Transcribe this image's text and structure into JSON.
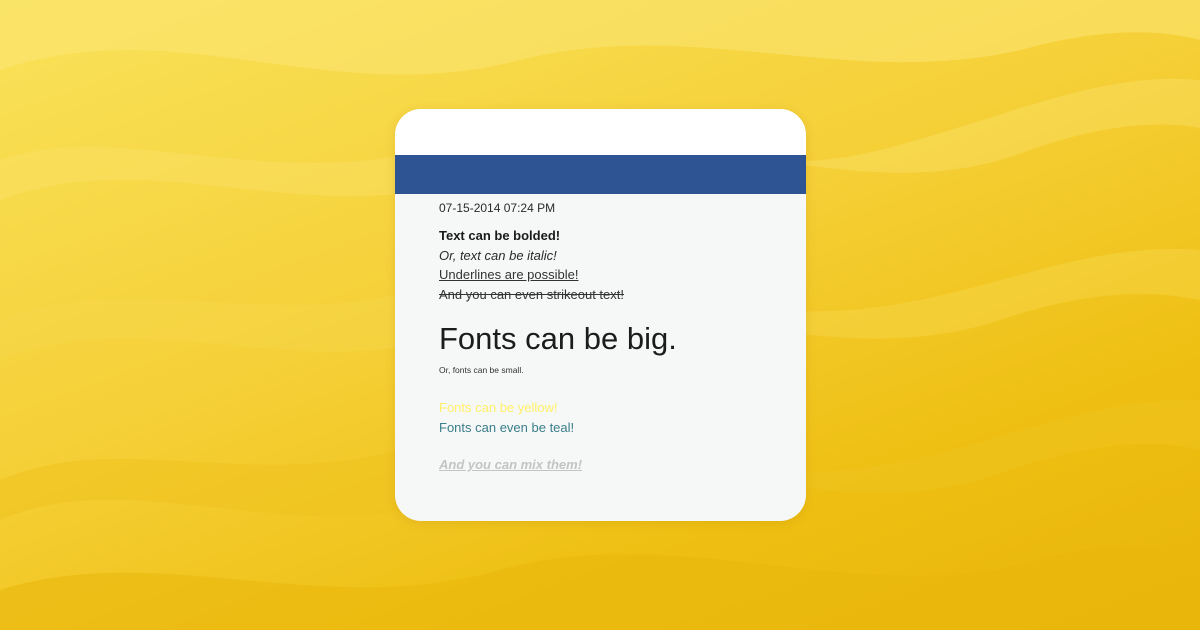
{
  "post": {
    "timestamp": "07-15-2014 07:24 PM",
    "lines": {
      "bold": "Text can be bolded!",
      "italic": "Or, text can be italic!",
      "underline": "Underlines are possible!",
      "strike": "And you can even strikeout text!",
      "big": "Fonts can be big.",
      "small": "Or, fonts can be small.",
      "yellow": "Fonts can be yellow!",
      "teal": "Fonts can even be teal!",
      "mixed": "And you can mix them!"
    }
  },
  "colors": {
    "header_bar": "#2f5494",
    "yellow_text": "#fff066",
    "teal_text": "#3a7f8a",
    "mixed_text": "#c4c4c4",
    "background": "#f5cf36"
  }
}
